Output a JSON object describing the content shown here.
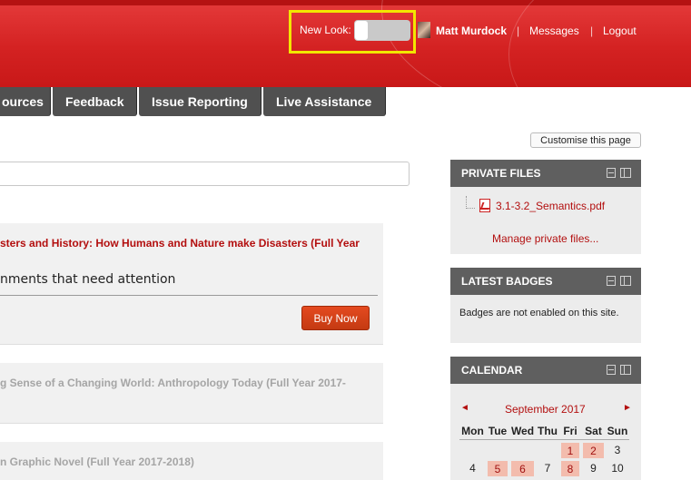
{
  "header": {
    "new_look_label": "New Look:",
    "user_name": "Matt Murdock",
    "separator": "|",
    "messages": "Messages",
    "logout": "Logout"
  },
  "nav": {
    "items": [
      "ources",
      "Feedback",
      "Issue Reporting",
      "Live Assistance"
    ]
  },
  "customise_button": "Customise this page",
  "courses": [
    {
      "title": "sters and History: How Humans and Nature make Disasters (Full Year",
      "assignments_text": "nments that need attention",
      "buy_label": "Buy Now"
    },
    {
      "title": "g Sense of a Changing World: Anthropology Today (Full Year 2017-"
    },
    {
      "title": "n Graphic Novel (Full Year 2017-2018)"
    }
  ],
  "blocks": {
    "private_files": {
      "title": "PRIVATE FILES",
      "file_name": "3.1-3.2_Semantics.pdf",
      "manage_link": "Manage private files..."
    },
    "latest_badges": {
      "title": "LATEST BADGES",
      "text": "Badges are not enabled on this site."
    },
    "calendar": {
      "title": "CALENDAR",
      "month": "September 2017",
      "prev": "◄",
      "next": "►",
      "weekdays": [
        "Mon",
        "Tue",
        "Wed",
        "Thu",
        "Fri",
        "Sat",
        "Sun"
      ],
      "week1": [
        "",
        "",
        "",
        "",
        "1",
        "2",
        "3"
      ],
      "week2": [
        "4",
        "5",
        "6",
        "7",
        "8",
        "9",
        "10"
      ]
    }
  },
  "colors": {
    "header_red": "#d42222",
    "highlight_box": "#f2e600",
    "link_red": "#b30f0f",
    "nav_gray": "#505050",
    "event_bg": "#f3bcad",
    "buy_button": "#d4421a"
  }
}
